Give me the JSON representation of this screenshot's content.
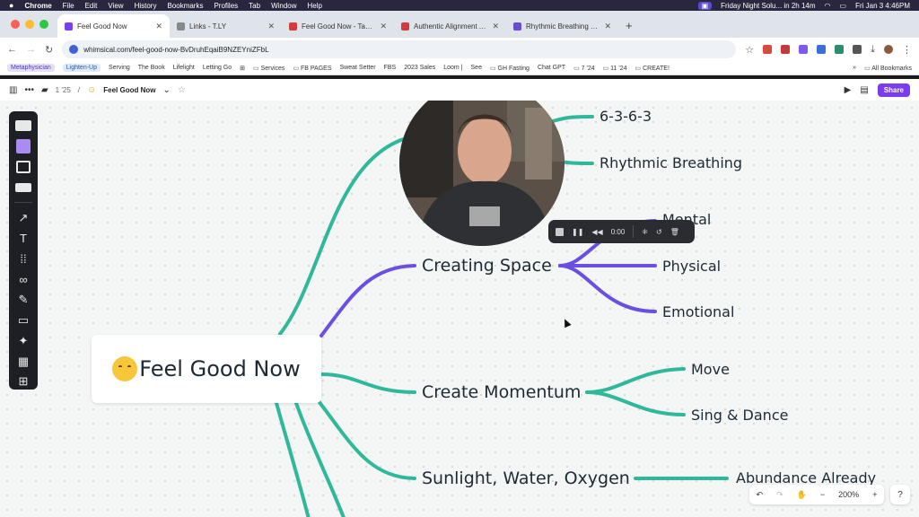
{
  "menubar": {
    "app": "Chrome",
    "items": [
      "File",
      "Edit",
      "View",
      "History",
      "Bookmarks",
      "Profiles",
      "Tab",
      "Window",
      "Help"
    ],
    "event": "Friday Night Solu... in 2h 14m",
    "clock": "Fri Jan 3  4:46PM"
  },
  "tabs": [
    {
      "title": "Feel Good Now",
      "color": "#7b3ff2",
      "active": true
    },
    {
      "title": "Links - T.LY",
      "color": "#888888"
    },
    {
      "title": "Feel Good Now - Take A Brea",
      "color": "#d23b3b"
    },
    {
      "title": "Authentic Alignment Alliance",
      "color": "#d23b3b"
    },
    {
      "title": "Rhythmic Breathing Easy as",
      "color": "#6b4bd6"
    }
  ],
  "address": {
    "url": "whimsical.com/feel-good-now-BvDruhEqaiB9NZEYniZFbL"
  },
  "bookmarks": {
    "items": [
      "Metaphysician",
      "Lighten-Up",
      "Serving",
      "The Book",
      "Lifelight",
      "Letting Go",
      "Services",
      "FB PAGES",
      "Sweat Setter",
      "FBS",
      "2023 Sales",
      "Loom |",
      "See",
      "GH Fasting",
      "Chat GPT",
      "7 '24",
      "11 '24",
      "CREATE!"
    ],
    "all": "All Bookmarks"
  },
  "appbar": {
    "folder": "1 '25",
    "doc": "Feel Good Now",
    "share": "Share"
  },
  "mindmap": {
    "root": "Feel Good Now",
    "branches": [
      {
        "label": "Creating Space",
        "children": [
          "Mental",
          "Physical",
          "Emotional"
        ]
      },
      {
        "label": "Create Momentum",
        "children": [
          "Move",
          "Sing & Dance"
        ]
      },
      {
        "label": "Sunlight, Water, Oxygen",
        "children": [
          "Abundance Already"
        ]
      }
    ],
    "top_children": [
      "6-3-6-3",
      "Rhythmic Breathing"
    ],
    "colors": {
      "teal": "#2fb89a",
      "purple": "#6b4fe0"
    }
  },
  "recorder": {
    "time": "0:00"
  },
  "zoom": {
    "level": "200%"
  }
}
